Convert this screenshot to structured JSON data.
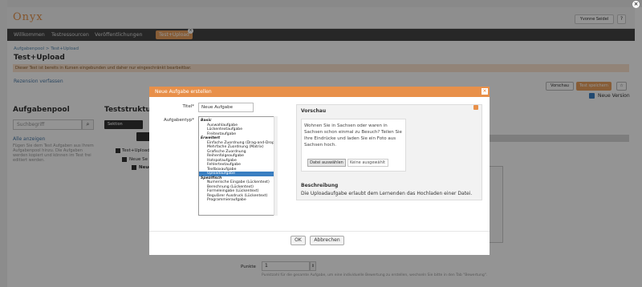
{
  "topbar": {
    "user_label": "Yvonne Seidel",
    "help_label": "?"
  },
  "logo": "Onyx",
  "nav": {
    "items": [
      "Willkommen",
      "Testressourcen",
      "Veröffentlichungen"
    ],
    "active_tab": "Test+Upload",
    "close_glyph": "×"
  },
  "breadcrumb": "Aufgabenpool > Test+Upload",
  "page_title": "Test+Upload",
  "warning": "Dieser Test ist bereits in Kursen eingebunden und daher nur eingeschränkt bearbeitbar.",
  "review_link": "Rezension verfassen",
  "toolbar": {
    "preview_label": "Vorschau",
    "save_label": "Test speichern",
    "star_glyph": "☆"
  },
  "version_label": "Neue Version",
  "pool": {
    "heading": "Aufgabenpool",
    "search_placeholder": "Suchbegriff",
    "show_all": "Alle anzeigen",
    "hint": "Fügen Sie dem Test Aufgaben aus Ihrem Aufgabenpool hinzu. Die Aufgaben werden kopiert und können im Test frei editiert werden."
  },
  "structure": {
    "heading": "Teststruktur",
    "section_btn": "Sektion",
    "tree": [
      "Test+Upload",
      "Neue Se",
      "Neue"
    ]
  },
  "points": {
    "label": "Punkte",
    "value": "1",
    "hint": "Punktzahl für die gesamte Aufgabe, um eine individuelle Bewertung zu erstellen, wechseln Sie bitte in den Tab \"Bewertung\"."
  },
  "modal": {
    "title": "Neue Aufgabe erstellen",
    "close_glyph": "×",
    "title_label": "Titel*",
    "title_value": "Neue Aufgabe",
    "type_label": "Aufgabentyp*",
    "options": [
      {
        "text": "Basic",
        "group": true
      },
      {
        "text": "Auswahlaufgabe",
        "group": false
      },
      {
        "text": "Lückentextaufgabe",
        "group": false
      },
      {
        "text": "Freitextaufgabe",
        "group": false
      },
      {
        "text": "Erweitert",
        "group": true
      },
      {
        "text": "Einfache Zuordnung (Drag-and-Drop)",
        "group": false
      },
      {
        "text": "Mehrfache Zuordnung (Matrix)",
        "group": false
      },
      {
        "text": "Grafische Zuordnung",
        "group": false
      },
      {
        "text": "Reihenfolgeaufgabe",
        "group": false
      },
      {
        "text": "Hotspotaufgabe",
        "group": false
      },
      {
        "text": "Fehlertextaufgabe",
        "group": false
      },
      {
        "text": "Textboxaufgabe",
        "group": false
      },
      {
        "text": "Uploadaufgabe",
        "group": false,
        "selected": true
      },
      {
        "text": "Spezifisch",
        "group": true
      },
      {
        "text": "Numerische Eingabe (Lückentext)",
        "group": false
      },
      {
        "text": "Berechnung (Lückentext)",
        "group": false
      },
      {
        "text": "Formeleingabe (Lückentext)",
        "group": false
      },
      {
        "text": "Regulärer Ausdruck (Lückentext)",
        "group": false
      },
      {
        "text": "Programmieraufgabe",
        "group": false
      }
    ],
    "preview_heading": "Vorschau",
    "preview_text": "Wohnen Sie in Sachsen oder waren in Sachsen schon einmal zu Besuch? Teilen Sie Ihre Eindrücke und laden Sie ein Foto aus Sachsen hoch.",
    "file_button": "Datei auswählen",
    "file_status": "Keine ausgewählt",
    "desc_heading": "Beschreibung",
    "desc_text": "Die Uploadaufgabe erlaubt dem Lernenden das Hochladen einer Datei.",
    "ok_label": "OK",
    "cancel_label": "Abbrechen"
  }
}
